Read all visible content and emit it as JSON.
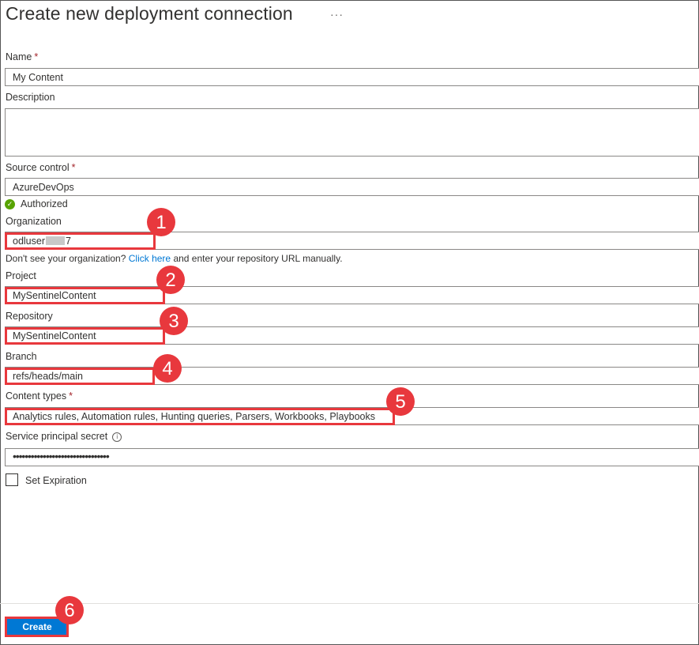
{
  "header": {
    "title": "Create new deployment connection",
    "more": "···"
  },
  "form": {
    "name": {
      "label": "Name",
      "required": "*",
      "value": "My Content"
    },
    "description": {
      "label": "Description",
      "value": ""
    },
    "source_control": {
      "label": "Source control",
      "required": "*",
      "value": "AzureDevOps",
      "status": "Authorized"
    },
    "organization": {
      "label": "Organization",
      "value_prefix": "odluser",
      "value_suffix": "7",
      "hint_prefix": "Don't see your organization?",
      "hint_link": "Click here",
      "hint_suffix": "and enter your repository URL manually."
    },
    "project": {
      "label": "Project",
      "value": "MySentinelContent"
    },
    "repository": {
      "label": "Repository",
      "value": "MySentinelContent"
    },
    "branch": {
      "label": "Branch",
      "value": "refs/heads/main"
    },
    "content_types": {
      "label": "Content types",
      "required": "*",
      "value": "Analytics rules, Automation rules, Hunting queries, Parsers, Workbooks, Playbooks"
    },
    "secret": {
      "label": "Service principal secret",
      "info": "i",
      "value": "••••••••••••••••••••••••••••••••"
    },
    "expiration": {
      "label": "Set Expiration"
    }
  },
  "footer": {
    "create_label": "Create"
  },
  "callouts": [
    "1",
    "2",
    "3",
    "4",
    "5",
    "6"
  ],
  "colors": {
    "accent": "#0078d4",
    "callout": "#e8383d",
    "authorized": "#57a300"
  }
}
